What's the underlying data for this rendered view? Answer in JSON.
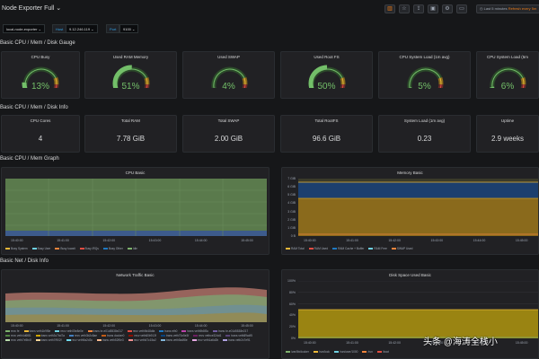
{
  "header": {
    "title": "Node Exporter Full ⌄",
    "icons": [
      {
        "name": "add-panel-icon",
        "glyph": "▥"
      },
      {
        "name": "star-icon",
        "glyph": "☆"
      },
      {
        "name": "share-icon",
        "glyph": "⇪"
      },
      {
        "name": "save-icon",
        "glyph": "▣"
      },
      {
        "name": "settings-icon",
        "glyph": "⚙"
      },
      {
        "name": "monitor-icon",
        "glyph": "▭"
      }
    ],
    "time_range": "Last 5 minutes",
    "refresh": "Refresh every 5m"
  },
  "variables": {
    "job_value": "local-node-exporter ⌄",
    "host_label": "Host",
    "host_value": "9.12.246.119 ⌄",
    "port_label": "Port",
    "port_value": "9100 ⌄"
  },
  "rows": {
    "gauge_row": "Basic CPU / Mem / Disk Gauge",
    "info_row": "Basic CPU / Mem / Disk Info",
    "graph_row": "Basic CPU / Mem Graph",
    "net_row": "Basic Net / Disk Info"
  },
  "gauges": [
    {
      "title": "CPU Busy",
      "value": "13%",
      "level": 13
    },
    {
      "title": "Used RAM Memory",
      "value": "51%",
      "level": 51
    },
    {
      "title": "Used SWAP",
      "value": "4%",
      "level": 4
    },
    {
      "title": "Used Root FS",
      "value": "50%",
      "level": 50
    },
    {
      "title": "CPU System Load (1m avg)",
      "value": "5%",
      "level": 5
    },
    {
      "title": "CPU System Load (5m",
      "value": "6%",
      "level": 6
    }
  ],
  "stats": [
    {
      "title": "CPU Cores",
      "value": "4"
    },
    {
      "title": "Total RAM",
      "value": "7.78 GiB"
    },
    {
      "title": "Total SWAP",
      "value": "2.00 GiB"
    },
    {
      "title": "Total RootFS",
      "value": "96.6 GiB"
    },
    {
      "title": "System Load (1m avg)",
      "value": "0.23"
    },
    {
      "title": "Uptime",
      "value": "2.9 weeks"
    }
  ],
  "cpu_basic": {
    "title": "CPU Basic",
    "x_ticks": [
      "15:40:00",
      "15:41:00",
      "15:42:00",
      "15:43:00",
      "15:44:00",
      "15:45:00"
    ],
    "legend": [
      {
        "label": "Busy System",
        "color": "#eab839"
      },
      {
        "label": "Busy User",
        "color": "#6ed0e0"
      },
      {
        "label": "Busy Iowait",
        "color": "#ef843c"
      },
      {
        "label": "Busy IRQs",
        "color": "#e24d42"
      },
      {
        "label": "Busy Other",
        "color": "#1f78c1"
      },
      {
        "label": "Idle",
        "color": "#7eb26d"
      }
    ]
  },
  "memory_basic": {
    "title": "Memory Basic",
    "y_ticks": [
      "7 GiB",
      "6 GiB",
      "5 GiB",
      "4 GiB",
      "3 GiB",
      "2 GiB",
      "1 GiB",
      "0 B"
    ],
    "x_ticks": [
      "15:40:00",
      "15:41:00",
      "15:42:00",
      "15:43:00",
      "15:44:00",
      "15:45:00"
    ],
    "legend": [
      {
        "label": "RAM Total",
        "color": "#eab839"
      },
      {
        "label": "RAM Used",
        "color": "#e24d42"
      },
      {
        "label": "RAM Cache + Buffer",
        "color": "#1f78c1"
      },
      {
        "label": "RAM Free",
        "color": "#6ed0e0"
      },
      {
        "label": "SWAP Used",
        "color": "#ef843c"
      }
    ]
  },
  "network_traffic": {
    "title": "Network Traffic Basic",
    "x_ticks": [
      "15:40:00",
      "15:41:00",
      "15:42:00",
      "15:43:00",
      "15:44:00",
      "15:45:00"
    ],
    "legend": [
      {
        "label": "recv fe",
        "color": "#7eb26d"
      },
      {
        "label": "trans veth1b9f5e",
        "color": "#eab839"
      },
      {
        "label": "recv veth05e8e0e",
        "color": "#6ed0e0"
      },
      {
        "label": "trans br-e01d5538e217",
        "color": "#ef843c"
      },
      {
        "label": "recv veth9d48dfa",
        "color": "#e24d42"
      },
      {
        "label": "trans eth0",
        "color": "#1f78c1"
      },
      {
        "label": "trans veth9b8f3c",
        "color": "#ba43a9"
      },
      {
        "label": "trans br-e01d5538e217",
        "color": "#705da0"
      },
      {
        "label": "recv veth4d6f81",
        "color": "#508642"
      },
      {
        "label": "trans veth3c7bd7a",
        "color": "#cca300"
      },
      {
        "label": "recv veth3b2c8ae",
        "color": "#447ebc"
      },
      {
        "label": "trans docker0",
        "color": "#c15c17"
      },
      {
        "label": "recv veth60b913f",
        "color": "#890f02"
      },
      {
        "label": "trans veth70c5e3f",
        "color": "#0a437c"
      },
      {
        "label": "recv vethce32dd1",
        "color": "#6d1f62"
      },
      {
        "label": "trans veth89cdf5",
        "color": "#584477"
      },
      {
        "label": "recv veth7e5b4f",
        "color": "#b7dbab"
      },
      {
        "label": "trans veth7f902f",
        "color": "#f4d598"
      },
      {
        "label": "recv veth9a2d3c",
        "color": "#70dbed"
      },
      {
        "label": "trans veth52f0e3",
        "color": "#f9ba8f"
      },
      {
        "label": "recv veth47c15a2",
        "color": "#f29191"
      },
      {
        "label": "trans veth5a4f8e",
        "color": "#82b5d8"
      },
      {
        "label": "recv veth1a6d2b",
        "color": "#e5a8e2"
      },
      {
        "label": "trans veth2c7e91",
        "color": "#aea2e0"
      }
    ]
  },
  "disk_space": {
    "title": "Disk Space Used Basic",
    "y_ticks": [
      "100%",
      "80%",
      "60%",
      "40%",
      "20%",
      "0%"
    ],
    "x_ticks": [
      "15:40:00",
      "15:41:00",
      "15:42:00",
      "15:43:00",
      "15:44:00",
      "15:45:00"
    ],
    "legend": [
      {
        "label": "/var/lib/docker",
        "color": "#7eb26d"
      },
      {
        "label": "/run/lock",
        "color": "#eab839"
      },
      {
        "label": "/run/user/1000",
        "color": "#6ed0e0"
      },
      {
        "label": "/run",
        "color": "#ef843c"
      },
      {
        "label": "/boot",
        "color": "#e24d42"
      }
    ]
  },
  "watermark": "头条 @海涛全栈小"
}
